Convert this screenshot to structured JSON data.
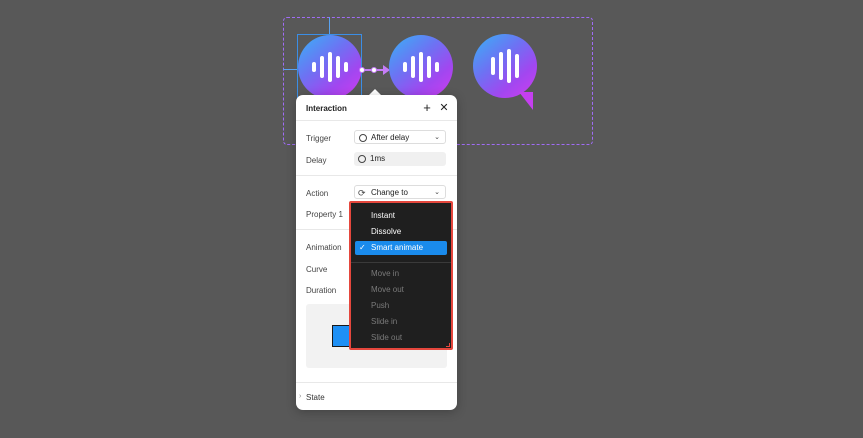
{
  "panel": {
    "title": "Interaction",
    "add_icon": "plus-icon",
    "close_icon": "close-icon"
  },
  "trigger": {
    "label": "Trigger",
    "value": "After delay"
  },
  "delay": {
    "label": "Delay",
    "value": "1ms"
  },
  "action": {
    "label": "Action",
    "value": "Change to"
  },
  "property": {
    "label": "Property 1"
  },
  "animation": {
    "label": "Animation"
  },
  "curve": {
    "label": "Curve"
  },
  "duration": {
    "label": "Duration"
  },
  "state": {
    "label": "State"
  },
  "dropdown": {
    "items": [
      {
        "label": "Instant",
        "enabled": true,
        "selected": false
      },
      {
        "label": "Dissolve",
        "enabled": true,
        "selected": false
      },
      {
        "label": "Smart animate",
        "enabled": true,
        "selected": true
      },
      {
        "label": "Move in",
        "enabled": false,
        "selected": false
      },
      {
        "label": "Move out",
        "enabled": false,
        "selected": false
      },
      {
        "label": "Push",
        "enabled": false,
        "selected": false
      },
      {
        "label": "Slide in",
        "enabled": false,
        "selected": false
      },
      {
        "label": "Slide out",
        "enabled": false,
        "selected": false
      }
    ]
  },
  "colors": {
    "canvas": "#585858",
    "selection": "#a06cf5",
    "accent": "#1a8bec",
    "highlight_border": "#e5473d"
  }
}
